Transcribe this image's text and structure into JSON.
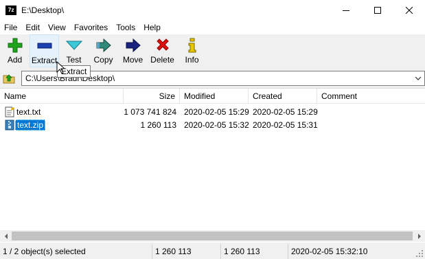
{
  "window": {
    "title": "E:\\Desktop\\",
    "app_icon_text": "7z"
  },
  "menu": [
    "File",
    "Edit",
    "View",
    "Favorites",
    "Tools",
    "Help"
  ],
  "toolbar": {
    "add": "Add",
    "extract": "Extract",
    "test": "Test",
    "copy": "Copy",
    "move": "Move",
    "delete": "Delete",
    "info": "Info"
  },
  "tooltip": "Extract",
  "address": {
    "path": "C:\\Users\\Bradr\\Desktop\\"
  },
  "columns": {
    "name": "Name",
    "size": "Size",
    "modified": "Modified",
    "created": "Created",
    "comment": "Comment"
  },
  "files": [
    {
      "name": "text.txt",
      "size": "1 073 741 824",
      "modified": "2020-02-05 15:29",
      "created": "2020-02-05 15:29",
      "comment": ""
    },
    {
      "name": "text.zip",
      "size": "1 260 113",
      "modified": "2020-02-05 15:32",
      "created": "2020-02-05 15:31",
      "comment": ""
    }
  ],
  "status": {
    "selection": "1 / 2 object(s) selected",
    "size": "1 260 113",
    "packed": "1 260 113",
    "modified": "2020-02-05 15:32:10"
  },
  "colors": {
    "selection": "#0078d7",
    "hover": "#e5f1fb",
    "add_icon": "#1fa31f",
    "extract_icon": "#1a3fb0",
    "test_icon": "#3cc8d8",
    "copy_icon": "#2f8a7a",
    "move_icon": "#1a237e",
    "delete_icon": "#e01010",
    "info_icon": "#e8c800"
  }
}
